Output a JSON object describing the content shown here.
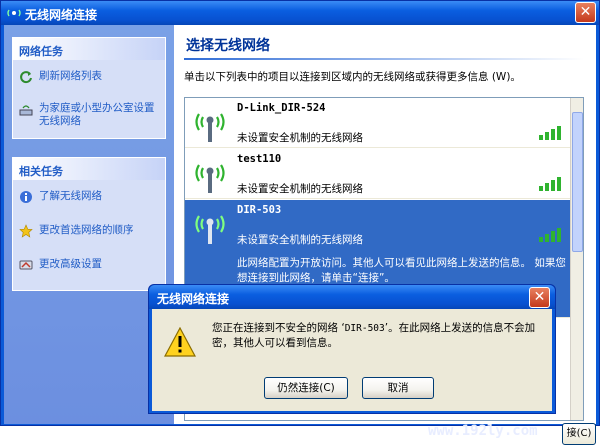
{
  "window": {
    "title": "无线网络连接"
  },
  "sidebar": {
    "tasks_header": "网络任务",
    "tasks": [
      {
        "label": "刷新网络列表",
        "icon": "refresh-icon"
      },
      {
        "label": "为家庭或小型办公室设置无线网络",
        "icon": "wireless-setup-icon"
      }
    ],
    "related_header": "相关任务",
    "related": [
      {
        "label": "了解无线网络",
        "icon": "info-icon"
      },
      {
        "label": "更改首选网络的顺序",
        "icon": "star-icon"
      },
      {
        "label": "更改高级设置",
        "icon": "settings-icon"
      }
    ]
  },
  "main": {
    "heading": "选择无线网络",
    "instruction": "单击以下列表中的项目以连接到区域内的无线网络或获得更多信息 (W)。",
    "networks": [
      {
        "ssid": "D-Link_DIR-524",
        "security": "未设置安全机制的无线网络",
        "signal_bars": 4
      },
      {
        "ssid": "test110",
        "security": "未设置安全机制的无线网络",
        "signal_bars": 4
      },
      {
        "ssid": "DIR-503",
        "security": "未设置安全机制的无线网络",
        "signal_bars": 4,
        "description": "此网络配置为开放访问。其他人可以看见此网络上发送的信息。 如果您想连接到此网络，请单击“连接”。"
      }
    ],
    "connect_button": "接(C)",
    "watermark": "www.192ly.com"
  },
  "dialog": {
    "title": "无线网络连接",
    "message_pre": "您正在连接到不安全的网络 ‘",
    "message_ssid": "DIR-503",
    "message_post": "’。在此网络上发送的信息不会加密，其他人可以看到信息。",
    "continue_button": "仍然连接(C)",
    "cancel_button": "取消"
  },
  "colors": {
    "title_blue": "#0a5ee0",
    "selection": "#316ac5",
    "link": "#215dc6",
    "signal_green": "#2fb32f"
  }
}
